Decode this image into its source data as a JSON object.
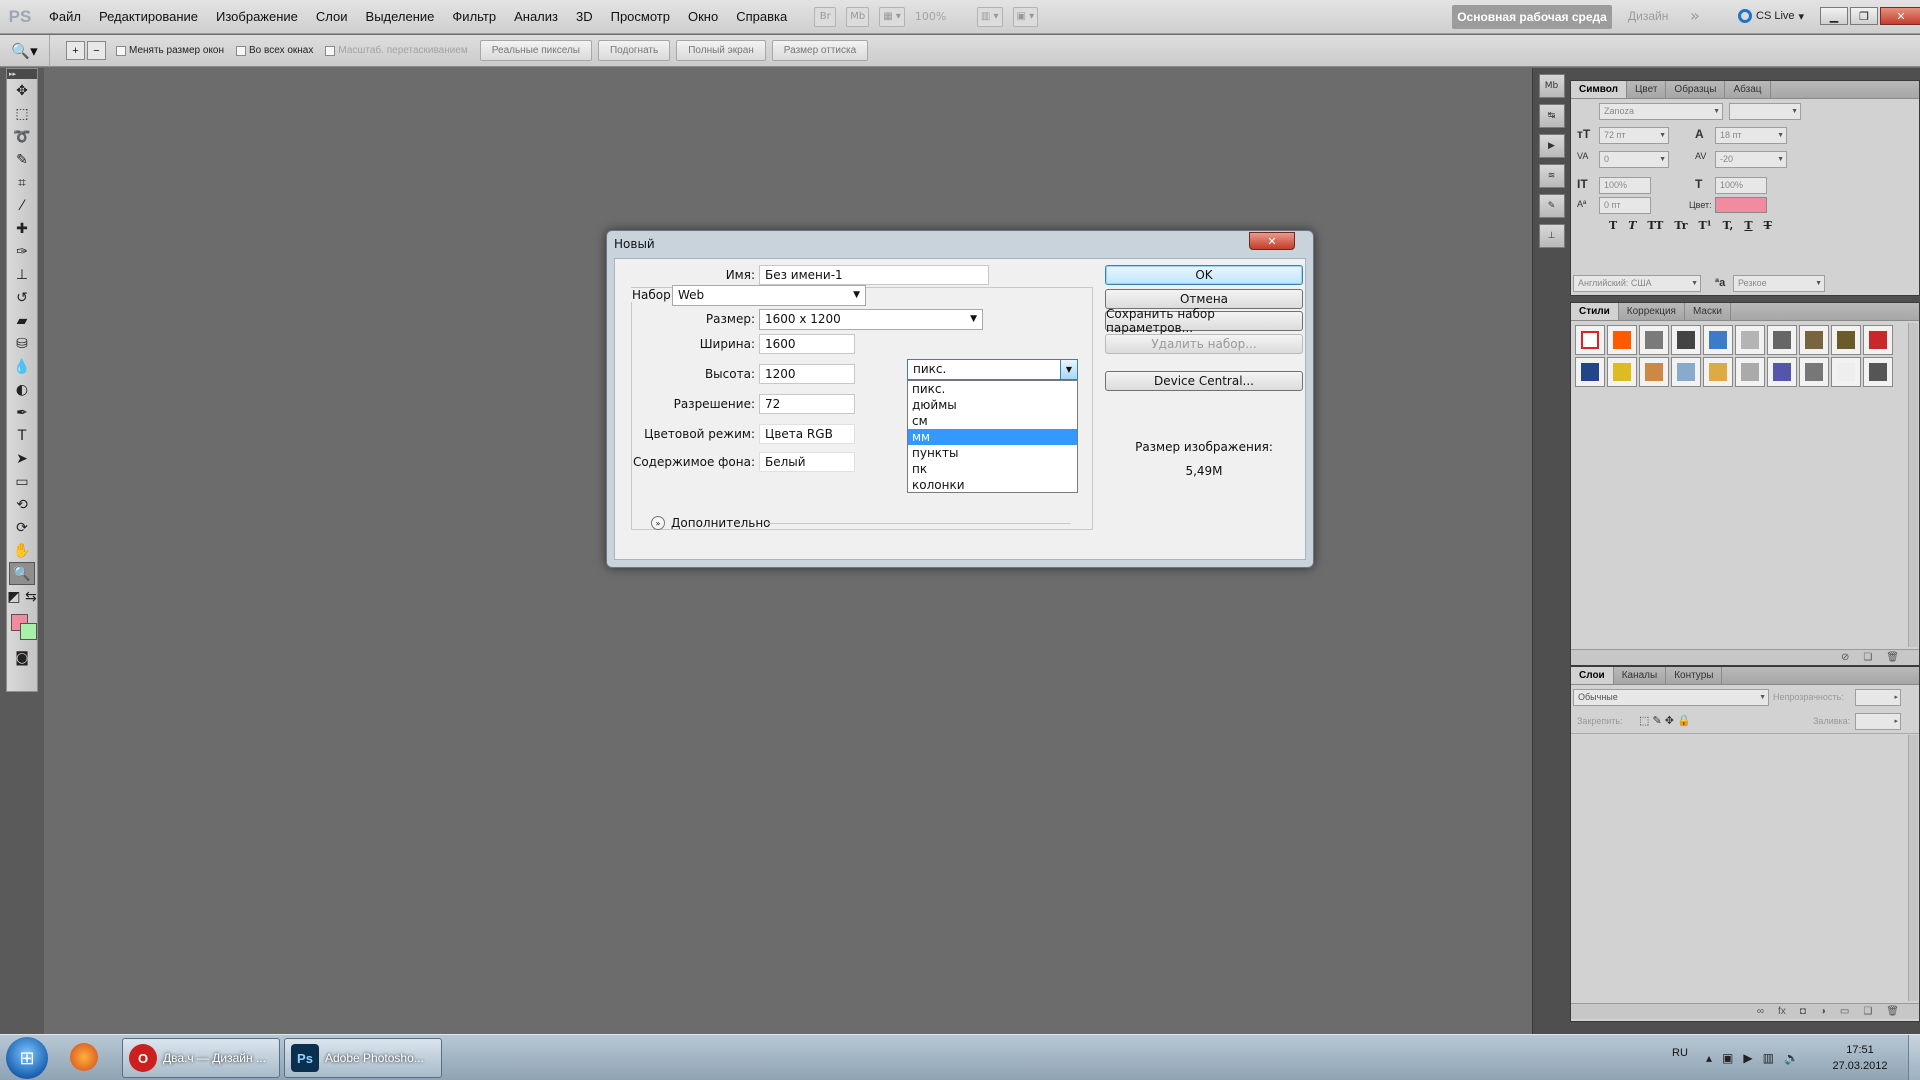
{
  "menubar": {
    "logo": "PS",
    "items": [
      "Файл",
      "Редактирование",
      "Изображение",
      "Слои",
      "Выделение",
      "Фильтр",
      "Анализ",
      "3D",
      "Просмотр",
      "Окно",
      "Справка"
    ],
    "icon_br": "Br",
    "icon_mb": "Mb",
    "zoom": "100%",
    "workspace_active": "Основная рабочая среда",
    "workspace_other": "Дизайн",
    "more": "»",
    "cslive": "CS Live"
  },
  "optbar": {
    "chk_resize": "Менять размер окон",
    "chk_all_windows": "Во всех окнах",
    "chk_scrubby": "Масштаб. перетаскиванием",
    "btn_actual": "Реальные пикселы",
    "btn_fit": "Подогнать",
    "btn_fill": "Полный экран",
    "btn_print": "Размер оттиска"
  },
  "dialog": {
    "title": "Новый",
    "name_label": "Имя:",
    "name_value": "Без имени-1",
    "preset_label": "Набор:",
    "preset_value": "Web",
    "size_label": "Размер:",
    "size_value": "1600 x 1200",
    "width_label": "Ширина:",
    "width_value": "1600",
    "height_label": "Высота:",
    "height_value": "1200",
    "resolution_label": "Разрешение:",
    "resolution_value": "72",
    "colormode_label": "Цветовой режим:",
    "colormode_value": "Цвета RGB",
    "background_label": "Содержимое фона:",
    "background_value": "Белый",
    "advanced_label": "Дополнительно",
    "unit_selected": "пикс.",
    "unit_options": [
      "пикс.",
      "дюймы",
      "см",
      "мм",
      "пункты",
      "пк",
      "колонки"
    ],
    "unit_highlighted": "мм",
    "btn_ok": "OK",
    "btn_cancel": "Отмена",
    "btn_save_preset": "Сохранить набор параметров...",
    "btn_delete_preset": "Удалить набор...",
    "btn_device_central": "Device Central...",
    "image_size_label": "Размер изображения:",
    "image_size_value": "5,49M"
  },
  "character_panel": {
    "tabs": [
      "Символ",
      "Цвет",
      "Образцы",
      "Абзац"
    ],
    "font": "Zanoza",
    "font_size": "72 пт",
    "leading": "18 пт",
    "kerning": "0",
    "tracking": "-20",
    "vscale": "100%",
    "hscale": "100%",
    "baseline": "0 пт",
    "color_label": "Цвет:",
    "color_value": "#f28aa0",
    "type_styles": [
      "T",
      "T",
      "TT",
      "Tr",
      "T¹",
      "T,",
      "T",
      "T"
    ],
    "language": "Английский: США",
    "aa_icon": "ªa",
    "antialias": "Резкое"
  },
  "styles_panel": {
    "tabs": [
      "Стили",
      "Коррекция",
      "Маски"
    ],
    "swatch_colors": [
      "#ffffff",
      "#ff5a00",
      "#7a7a7a",
      "#444444",
      "#3b7bc8",
      "#b4b4b4",
      "#666666",
      "#7a6440",
      "#6b5a2a",
      "#c82828",
      "#224488",
      "#ddbb22",
      "#cc8844",
      "#88aacc",
      "#ddaa44",
      "#aaaaaa",
      "#5555aa",
      "#777777",
      "#eeeeee",
      "#555555"
    ]
  },
  "layers_panel": {
    "tabs": [
      "Слои",
      "Каналы",
      "Контуры"
    ],
    "blend_mode": "Обычные",
    "opacity_label": "Непрозрачность:",
    "lock_label": "Закрепить:",
    "fill_label": "Заливка:"
  },
  "taskbar": {
    "apps": [
      {
        "icon": "O",
        "label": "Два.ч — Дизайн ..."
      },
      {
        "icon": "Ps",
        "label": "Adobe Photosho..."
      }
    ],
    "lang": "RU",
    "time": "17:51",
    "date": "27.03.2012"
  }
}
